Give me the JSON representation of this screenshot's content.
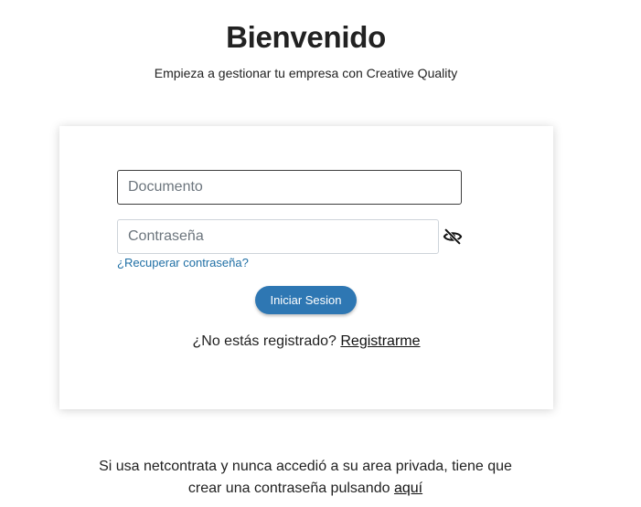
{
  "header": {
    "title": "Bienvenido",
    "subtitle": "Empieza a gestionar tu empresa con Creative Quality"
  },
  "login_form": {
    "document_placeholder": "Documento",
    "password_placeholder": "Contraseña",
    "toggle_visibility_icon": "eye-slash-icon",
    "recover_link": "¿Recuperar contraseña?",
    "submit_label": "Iniciar Sesion",
    "register_prompt": "¿No estás registrado?",
    "register_link": "Registrarme"
  },
  "footer": {
    "note": "Si usa netcontrata y nunca accedió a su area privada, tiene que crear una contraseña pulsando",
    "link": "aquí"
  },
  "colors": {
    "primary_button": "#2e77b3",
    "link": "#1f6fa5"
  }
}
